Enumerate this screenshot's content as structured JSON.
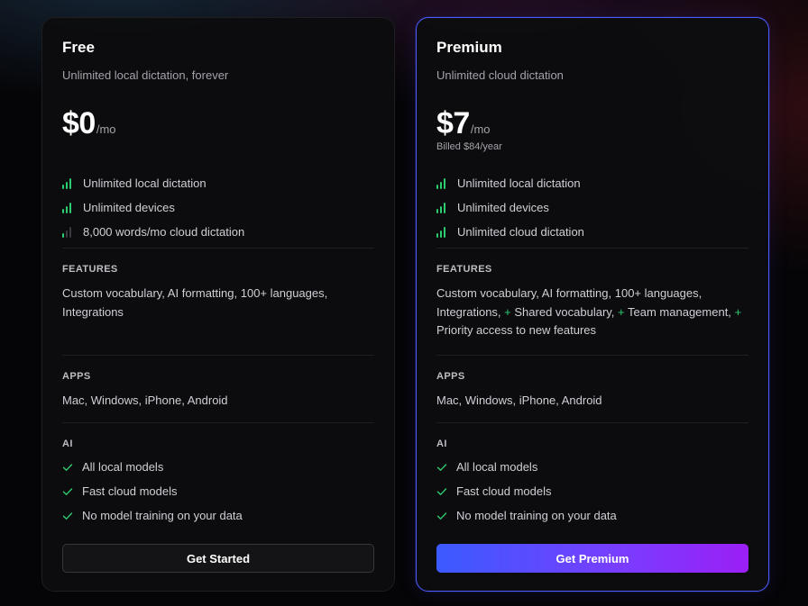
{
  "colors": {
    "accent_green": "#2ecc71",
    "premium_border": "#4a5cff",
    "premium_gradient_start": "#3b5bff",
    "premium_gradient_end": "#9b1ff5"
  },
  "plans": [
    {
      "name": "Free",
      "description": "Unlimited local dictation, forever",
      "price": "$0",
      "price_unit": "/mo",
      "billed": "",
      "usage": [
        {
          "label": "Unlimited local dictation",
          "icon": "signal-bars-full-icon"
        },
        {
          "label": "Unlimited devices",
          "icon": "signal-bars-full-icon"
        },
        {
          "label": "8,000 words/mo cloud dictation",
          "icon": "signal-bars-partial-icon"
        }
      ],
      "features_label": "FEATURES",
      "features_text": "Custom vocabulary, AI formatting, 100+ languages, Integrations",
      "apps_label": "APPS",
      "apps_text": "Mac, Windows, iPhone, Android",
      "ai_label": "AI",
      "ai_items": [
        "All local models",
        "Fast cloud models",
        "No model training on your data"
      ],
      "cta": "Get Started"
    },
    {
      "name": "Premium",
      "description": "Unlimited cloud dictation",
      "price": "$7",
      "price_unit": "/mo",
      "billed": "Billed $84/year",
      "usage": [
        {
          "label": "Unlimited local dictation",
          "icon": "signal-bars-full-icon"
        },
        {
          "label": "Unlimited devices",
          "icon": "signal-bars-full-icon"
        },
        {
          "label": "Unlimited cloud dictation",
          "icon": "signal-bars-full-icon"
        }
      ],
      "features_label": "FEATURES",
      "features_base": "Custom vocabulary, AI formatting, 100+ languages, Integrations, ",
      "features_extras": [
        "Shared vocabulary,",
        "Team management,",
        "Priority access to new features"
      ],
      "plus_symbol": "+",
      "apps_label": "APPS",
      "apps_text": "Mac, Windows, iPhone, Android",
      "ai_label": "AI",
      "ai_items": [
        "All local models",
        "Fast cloud models",
        "No model training on your data"
      ],
      "cta": "Get Premium"
    }
  ]
}
